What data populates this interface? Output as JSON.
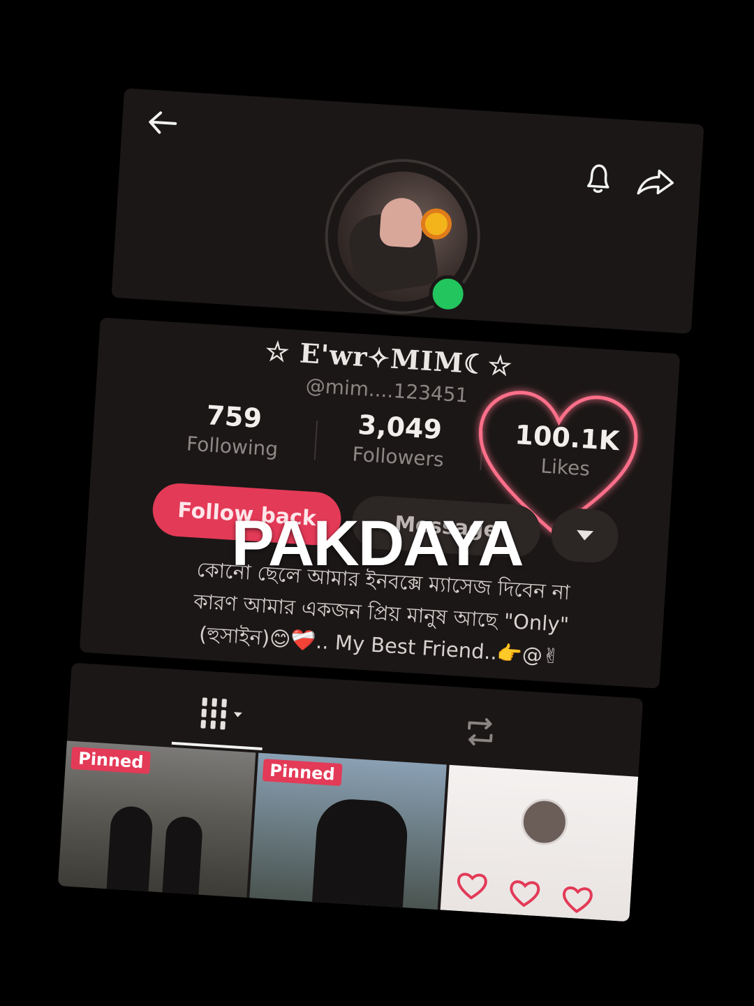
{
  "header": {
    "back_icon": "arrow-left-icon",
    "bell_icon": "bell-icon",
    "share_icon": "share-arrow-icon"
  },
  "profile": {
    "display_name": "☆ E'wr✧MIM☾☆",
    "handle": "@mim....123451",
    "stats": {
      "following": {
        "value": "759",
        "label": "Following"
      },
      "followers": {
        "value": "3,049",
        "label": "Followers"
      },
      "likes": {
        "value": "100.1K",
        "label": "Likes"
      }
    },
    "follow_back_label": "Follow back",
    "message_label": "Message",
    "more_icon": "caret-down-icon",
    "bio_line1": "কোনো ছেলে আমার ইনবক্সে ম্যাসেজ দিবেন না",
    "bio_line2": "কারণ আমার একজন প্রিয় মানুষ আছে \"Only\"",
    "bio_line3": "(হুসাইন)😊❤️‍🩹.. My Best Friend..👉@✌"
  },
  "tabs": {
    "videos_icon": "grid-icon",
    "reposts_icon": "repost-icon"
  },
  "grid": {
    "pinned_label": "Pinned"
  },
  "overlay": {
    "title": "PAKDAYA"
  },
  "colors": {
    "accent": "#e33a57",
    "online": "#22c55e",
    "neon_heart": "#ff6f8a"
  }
}
